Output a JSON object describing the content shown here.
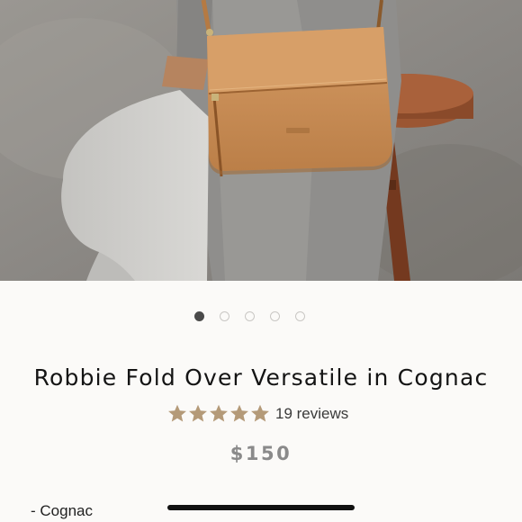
{
  "product": {
    "title": "Robbie Fold Over Versatile in Cognac",
    "rating_stars": 5,
    "reviews_text": "19 reviews",
    "price": "$150",
    "variant_line": "- Cognac"
  },
  "carousel": {
    "total_images": 5,
    "active_index": 0
  },
  "colors": {
    "star": "#b49a78",
    "bag_leather": "#c98d56",
    "active_dot": "#4a4a4a",
    "price_text": "#8a8a8a"
  },
  "icons": {
    "star": "star-icon"
  }
}
